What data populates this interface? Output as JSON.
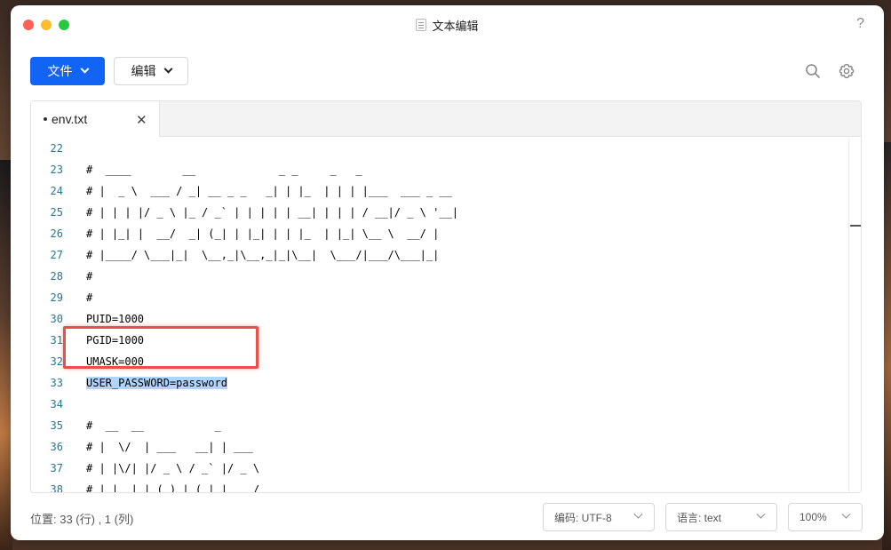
{
  "window": {
    "title": "文本编辑",
    "help": "?"
  },
  "toolbar": {
    "file_label": "文件",
    "edit_label": "编辑"
  },
  "tabs": [
    {
      "label": "env.txt",
      "modified": true
    }
  ],
  "editor": {
    "lines": [
      {
        "num": "22",
        "text": ""
      },
      {
        "num": "23",
        "text": "#  ____        __             _ _     _   _"
      },
      {
        "num": "24",
        "text": "# |  _ \\  ___ / _| __ _ _   _| | |_  | | | |___  ___ _ __"
      },
      {
        "num": "25",
        "text": "# | | | |/ _ \\ |_ / _` | | | | | __| | | | / __|/ _ \\ '__|"
      },
      {
        "num": "26",
        "text": "# | |_| |  __/  _| (_| | |_| | | |_  | |_| \\__ \\  __/ |"
      },
      {
        "num": "27",
        "text": "# |____/ \\___|_|  \\__,_|\\__,_|_|\\__|  \\___/|___/\\___|_|"
      },
      {
        "num": "28",
        "text": "#"
      },
      {
        "num": "29",
        "text": "#"
      },
      {
        "num": "30",
        "text": "PUID=1000"
      },
      {
        "num": "31",
        "text": "PGID=1000"
      },
      {
        "num": "32",
        "text": "UMASK=000"
      },
      {
        "num": "33",
        "text": "USER_PASSWORD=password",
        "selected": true
      },
      {
        "num": "34",
        "text": ""
      },
      {
        "num": "35",
        "text": "#  __  __           _"
      },
      {
        "num": "36",
        "text": "# |  \\/  | ___   __| | ___"
      },
      {
        "num": "37",
        "text": "# | |\\/| |/ _ \\ / _` |/ _ \\"
      },
      {
        "num": "38",
        "text": "# | |  | | (_) | (_| |  __/"
      }
    ]
  },
  "status": {
    "position": "位置: 33 (行) , 1 (列)",
    "encoding": "编码: UTF-8",
    "language": "语言: text",
    "zoom": "100%"
  },
  "colors": {
    "accent": "#1264f5",
    "selection": "#add6ff",
    "annotation": "#e8514a",
    "line_number": "#237893"
  }
}
